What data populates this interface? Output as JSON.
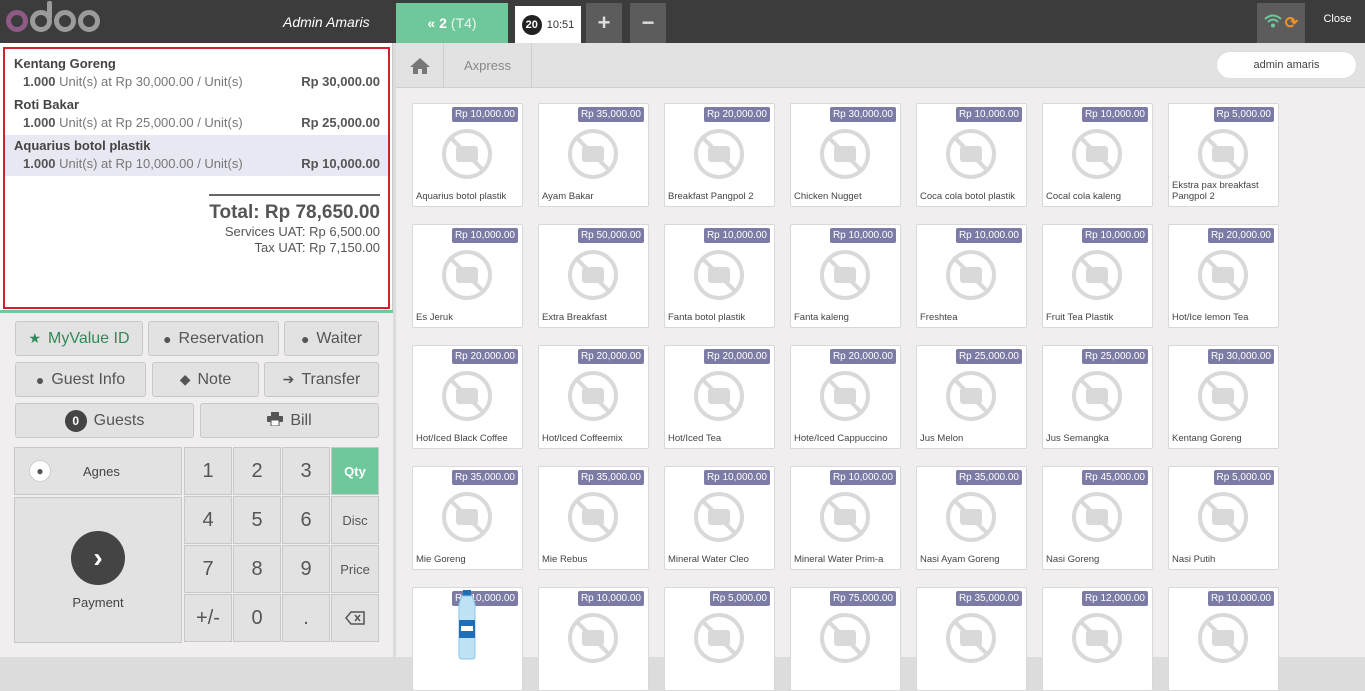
{
  "topbar": {
    "user": "Admin Amaris",
    "active_order": {
      "number": "2",
      "table": "(T4)"
    },
    "order_tab": {
      "count": "20",
      "time": "10:51"
    },
    "add_label": "+",
    "remove_label": "−",
    "close_label": "Close"
  },
  "order": {
    "lines": [
      {
        "name": "Kentang Goreng",
        "qty": "1.000",
        "detail": "Unit(s) at Rp 30,000.00 / Unit(s)",
        "price": "Rp 30,000.00",
        "selected": false
      },
      {
        "name": "Roti Bakar",
        "qty": "1.000",
        "detail": "Unit(s) at Rp 25,000.00 / Unit(s)",
        "price": "Rp 25,000.00",
        "selected": false
      },
      {
        "name": "Aquarius botol plastik",
        "qty": "1.000",
        "detail": "Unit(s) at Rp 10,000.00 / Unit(s)",
        "price": "Rp 10,000.00",
        "selected": true
      }
    ],
    "total": "Total: Rp 78,650.00",
    "services": "Services UAT: Rp 6,500.00",
    "tax": "Tax UAT: Rp 7,150.00"
  },
  "controls": {
    "myvalue": "MyValue ID",
    "reservation": "Reservation",
    "waiter": "Waiter",
    "guest_info": "Guest Info",
    "note": "Note",
    "transfer": "Transfer",
    "guests_count": "0",
    "guests": "Guests",
    "bill": "Bill"
  },
  "numpad": {
    "customer": "Agnes",
    "payment": "Payment",
    "keys": [
      "1",
      "2",
      "3",
      "4",
      "5",
      "6",
      "7",
      "8",
      "9",
      "+/-",
      "0",
      "."
    ],
    "modes": [
      "Qty",
      "Disc",
      "Price"
    ],
    "active_mode": "Qty"
  },
  "breadcrumb": {
    "category": "Axpress",
    "user_pill": "admin amaris"
  },
  "products": [
    {
      "name": "Aquarius botol plastik",
      "price": "Rp 10,000.00"
    },
    {
      "name": "Ayam Bakar",
      "price": "Rp 35,000.00"
    },
    {
      "name": "Breakfast Pangpol 2",
      "price": "Rp 20,000.00"
    },
    {
      "name": "Chicken Nugget",
      "price": "Rp 30,000.00"
    },
    {
      "name": "Coca cola botol plastik",
      "price": "Rp 10,000.00"
    },
    {
      "name": "Cocal cola kaleng",
      "price": "Rp 10,000.00"
    },
    {
      "name": "Ekstra pax breakfast Pangpol 2",
      "price": "Rp 5,000.00"
    },
    {
      "name": "Es Jeruk",
      "price": "Rp 10,000.00"
    },
    {
      "name": "Extra Breakfast",
      "price": "Rp 50,000.00"
    },
    {
      "name": "Fanta botol plastik",
      "price": "Rp 10,000.00"
    },
    {
      "name": "Fanta kaleng",
      "price": "Rp 10,000.00"
    },
    {
      "name": "Freshtea",
      "price": "Rp 10,000.00"
    },
    {
      "name": "Fruit Tea Plastik",
      "price": "Rp 10,000.00"
    },
    {
      "name": "Hot/Ice lemon Tea",
      "price": "Rp 20,000.00"
    },
    {
      "name": "Hot/Iced Black Coffee",
      "price": "Rp 20,000.00"
    },
    {
      "name": "Hot/Iced Coffeemix",
      "price": "Rp 20,000.00"
    },
    {
      "name": "Hot/Iced Tea",
      "price": "Rp 20,000.00"
    },
    {
      "name": "Hote/Iced Cappuccino",
      "price": "Rp 20,000.00"
    },
    {
      "name": "Jus Melon",
      "price": "Rp 25,000.00"
    },
    {
      "name": "Jus Semangka",
      "price": "Rp 25,000.00"
    },
    {
      "name": "Kentang Goreng",
      "price": "Rp 30,000.00"
    },
    {
      "name": "Mie Goreng",
      "price": "Rp 35,000.00"
    },
    {
      "name": "Mie Rebus",
      "price": "Rp 35,000.00"
    },
    {
      "name": "Mineral Water Cleo",
      "price": "Rp 10,000.00"
    },
    {
      "name": "Mineral Water Prim-a",
      "price": "Rp 10,000.00"
    },
    {
      "name": "Nasi Ayam Goreng",
      "price": "Rp 35,000.00"
    },
    {
      "name": "Nasi Goreng",
      "price": "Rp 45,000.00"
    },
    {
      "name": "Nasi Putih",
      "price": "Rp 5,000.00"
    },
    {
      "name": "",
      "price": "Rp 10,000.00",
      "image": "water-bottle"
    },
    {
      "name": "",
      "price": "Rp 10,000.00"
    },
    {
      "name": "",
      "price": "Rp 5,000.00"
    },
    {
      "name": "",
      "price": "Rp 75,000.00"
    },
    {
      "name": "",
      "price": "Rp 35,000.00"
    },
    {
      "name": "",
      "price": "Rp 12,000.00"
    },
    {
      "name": "",
      "price": "Rp 10,000.00"
    }
  ],
  "colors": {
    "accent_green": "#6ec89b",
    "price_badge": "#7c7ba5",
    "highlight_red": "#d0212f"
  }
}
